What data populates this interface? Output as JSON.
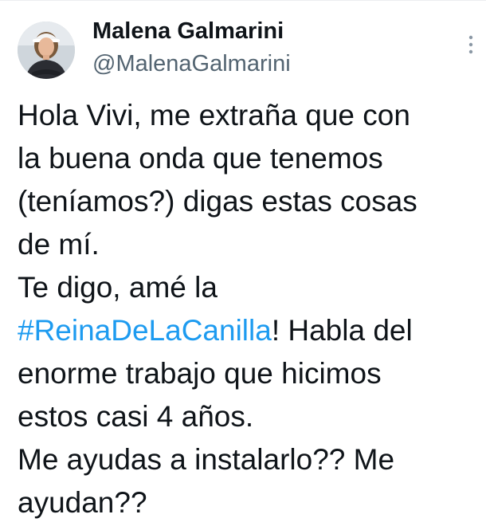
{
  "user": {
    "display_name": "Malena Galmarini",
    "handle": "@MalenaGalmarini",
    "avatar_icon": "profile-photo"
  },
  "menu": {
    "icon": "more-vertical-icon"
  },
  "tweet": {
    "line_1": "Hola Vivi, me extraña que con",
    "line_2": "la buena onda que tenemos",
    "line_3": "(teníamos?) digas estas cosas",
    "line_4": "de mí.",
    "line_5": "Te digo, amé la",
    "hashtag": "#ReinaDeLaCanilla",
    "line_6_rest": "! Habla del",
    "line_7": "enorme trabajo que hicimos",
    "line_8": "estos casi 4 años.",
    "line_9": "Me ayudas a instalarlo?? Me",
    "line_10": "ayudan??"
  },
  "colors": {
    "text": "#0f1419",
    "secondary": "#536471",
    "link": "#1d9bf0"
  }
}
